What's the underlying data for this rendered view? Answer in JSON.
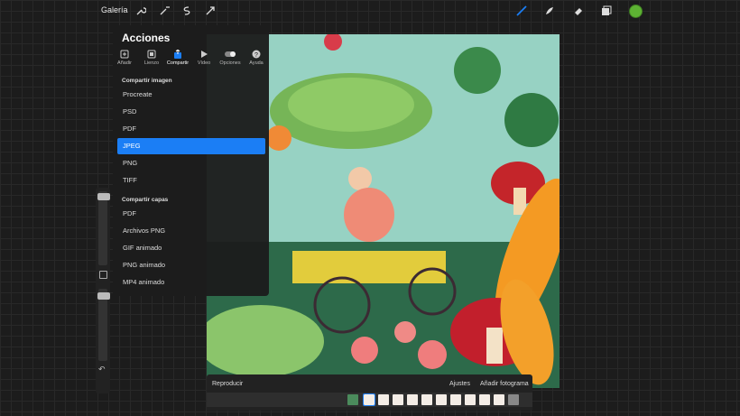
{
  "topbar": {
    "gallery_label": "Galería",
    "left_tools": [
      "wrench-icon",
      "magic-wand-icon",
      "selection-icon",
      "transform-icon"
    ],
    "right_tools": [
      "brush-icon",
      "smudge-icon",
      "eraser-icon",
      "layers-icon"
    ],
    "active_color": "#5db233",
    "accent": "#1b7ef5"
  },
  "panel": {
    "title": "Acciones",
    "tabs": [
      {
        "label": "Añadir",
        "icon": "add-icon"
      },
      {
        "label": "Lienzo",
        "icon": "canvas-icon"
      },
      {
        "label": "Compartir",
        "icon": "share-icon",
        "active": true
      },
      {
        "label": "Vídeo",
        "icon": "video-icon"
      },
      {
        "label": "Opciones",
        "icon": "toggle-icon"
      },
      {
        "label": "Ayuda",
        "icon": "help-icon"
      }
    ],
    "section_image": "Compartir imagen",
    "image_items": [
      "Procreate",
      "PSD",
      "PDF",
      "JPEG",
      "PNG",
      "TIFF"
    ],
    "selected_item": "JPEG",
    "section_layers": "Compartir capas",
    "layer_items": [
      "PDF",
      "Archivos PNG",
      "GIF animado",
      "PNG animado",
      "MP4 animado"
    ]
  },
  "timeline": {
    "play_label": "Reproducir",
    "settings_label": "Ajustes",
    "add_frame_label": "Añadir fotograma"
  }
}
